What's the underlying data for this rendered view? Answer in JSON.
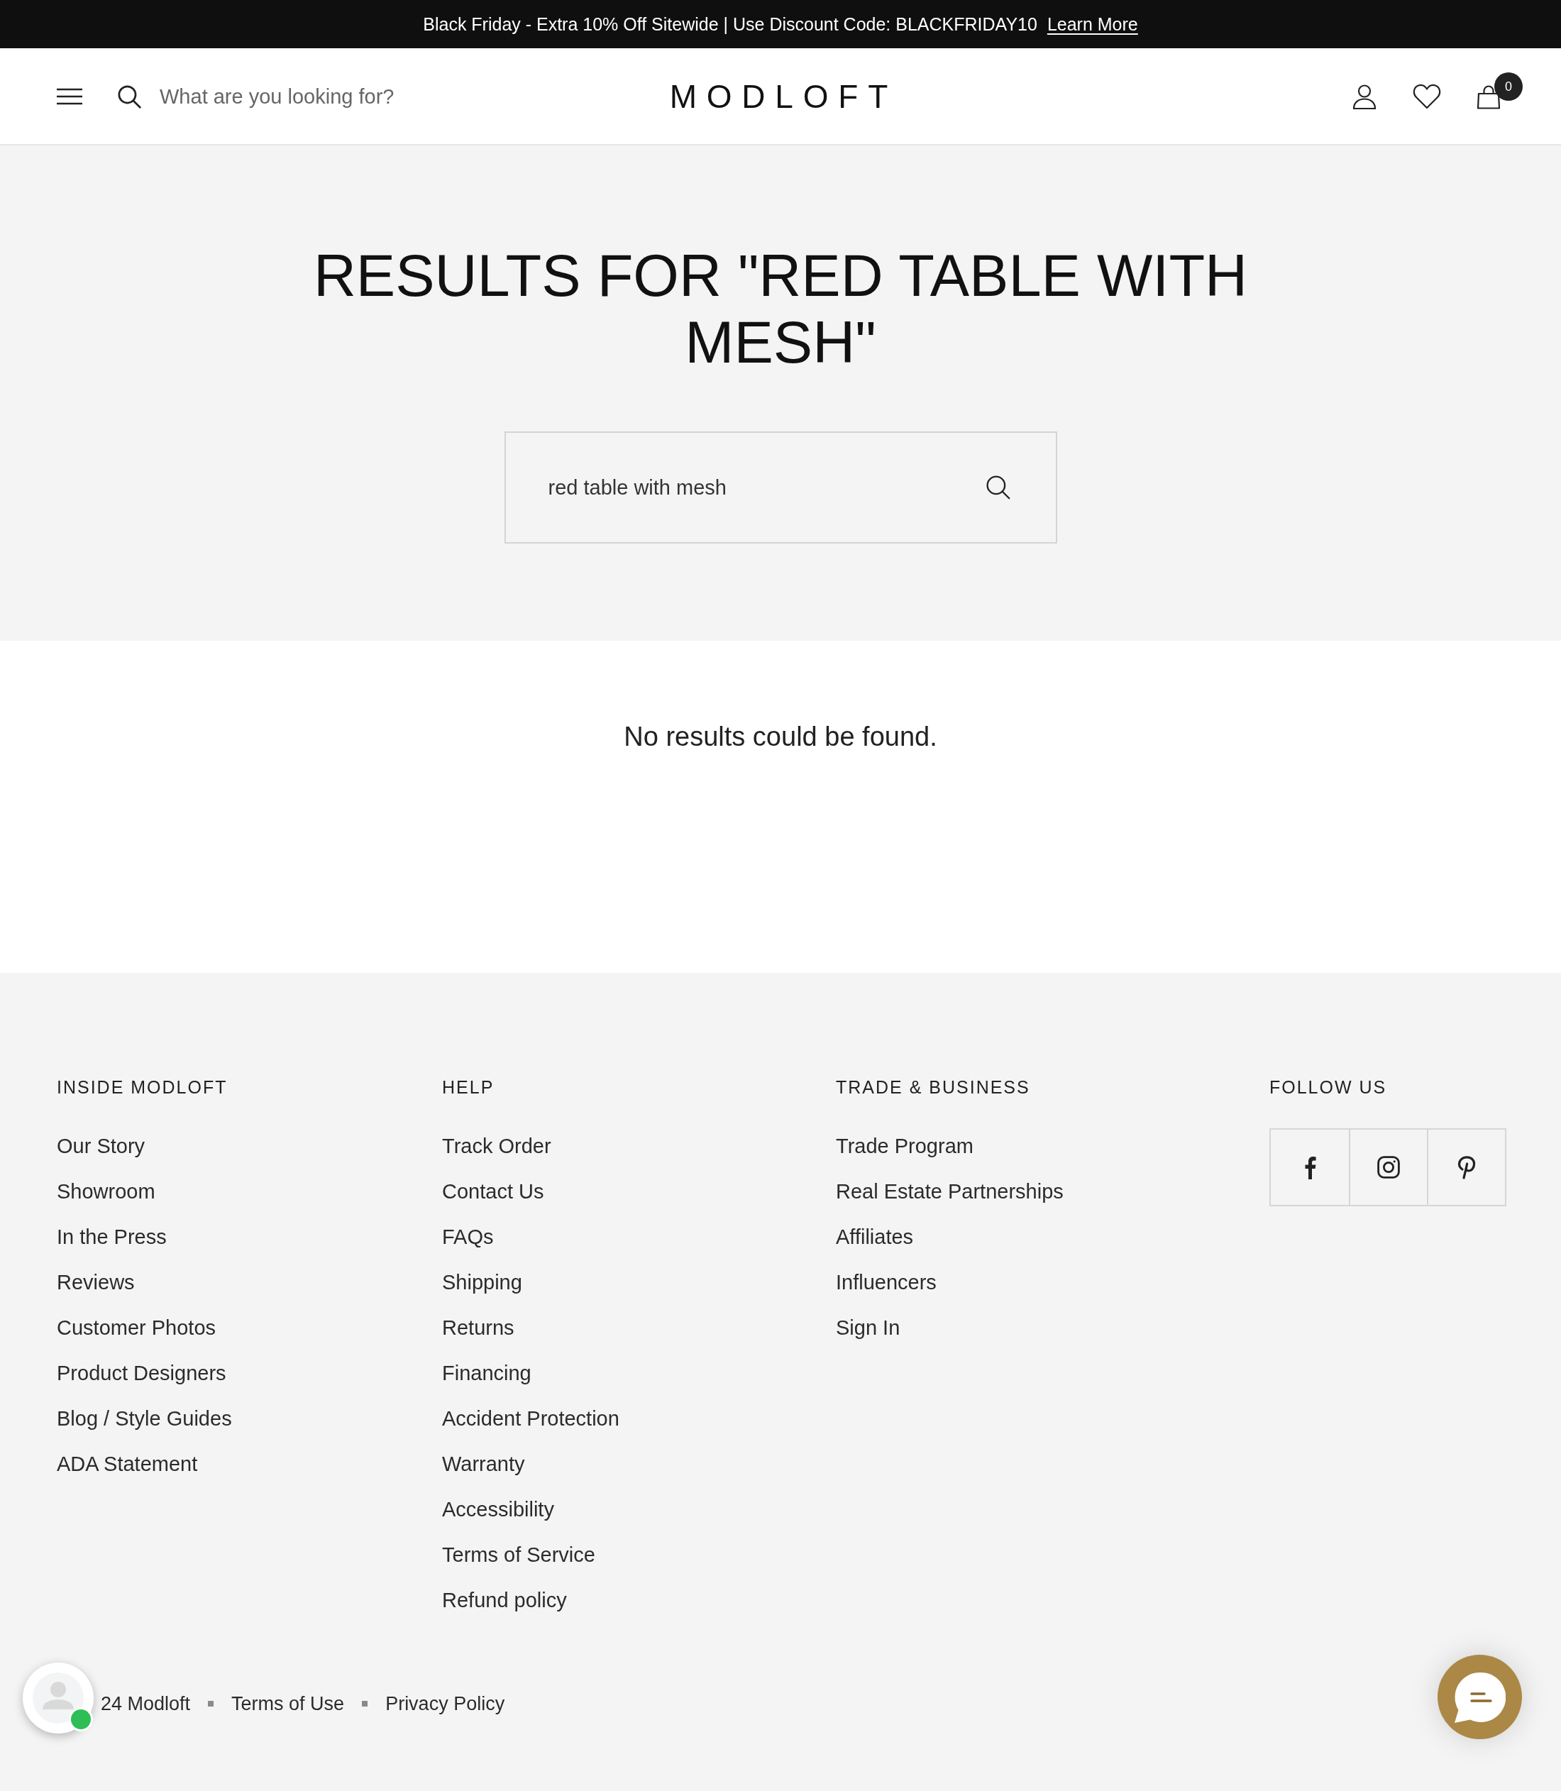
{
  "announcement_bar": {
    "text": "Black Friday - Extra 10% Off Sitewide | Use Discount Code: BLACKFRIDAY10",
    "link": "Learn More"
  },
  "header": {
    "search": {
      "placeholder": "What are you looking for?"
    },
    "logo": "MODLOFT",
    "cart_count": "0"
  },
  "results": {
    "title": "RESULTS FOR \"RED TABLE WITH MESH\"",
    "search": {
      "value": "red table with mesh"
    },
    "message": "No results could be found."
  },
  "footer": {
    "columns": [
      {
        "heading": "INSIDE MODLOFT",
        "links": [
          "Our Story",
          "Showroom",
          "In the Press",
          "Reviews",
          "Customer Photos",
          "Product Designers",
          "Blog / Style Guides",
          "ADA Statement"
        ]
      },
      {
        "heading": "HELP",
        "links": [
          "Track Order",
          "Contact Us",
          "FAQs",
          "Shipping",
          "Returns",
          "Financing",
          "Accident Protection",
          "Warranty",
          "Accessibility",
          "Terms of Service",
          "Refund policy"
        ]
      },
      {
        "heading": "TRADE & BUSINESS",
        "links": [
          "Trade Program",
          "Real Estate Partnerships",
          "Affiliates",
          "Influencers",
          "Sign In"
        ]
      }
    ],
    "follow": {
      "heading": "FOLLOW US",
      "social": [
        {
          "kind": "facebook"
        },
        {
          "kind": "instagram"
        },
        {
          "kind": "pinterest"
        }
      ]
    }
  },
  "bottom": {
    "copyright": "24 Modloft",
    "links": [
      "Terms of Use",
      "Privacy Policy"
    ]
  }
}
